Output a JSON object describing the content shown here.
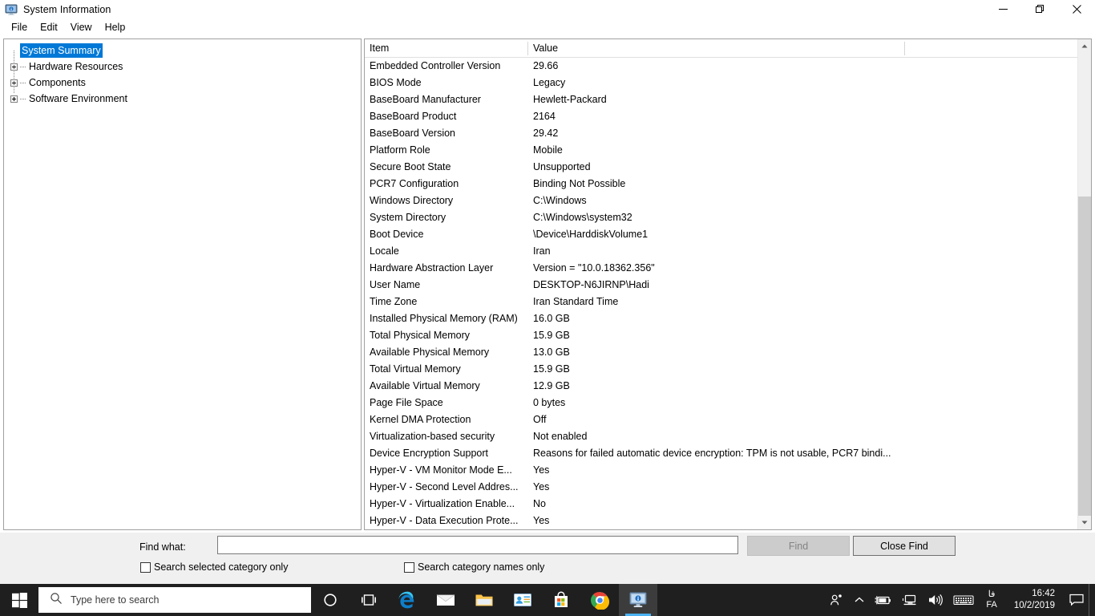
{
  "window": {
    "title": "System Information",
    "icon": "system-information-icon",
    "controls": {
      "minimize": "minimize-icon",
      "maximize": "restore-icon",
      "close": "close-icon"
    }
  },
  "menubar": {
    "items": [
      {
        "label": "File"
      },
      {
        "label": "Edit"
      },
      {
        "label": "View"
      },
      {
        "label": "Help"
      }
    ]
  },
  "tree": {
    "nodes": [
      {
        "label": "System Summary",
        "selected": true,
        "expandable": false
      },
      {
        "label": "Hardware Resources",
        "selected": false,
        "expandable": true
      },
      {
        "label": "Components",
        "selected": false,
        "expandable": true
      },
      {
        "label": "Software Environment",
        "selected": false,
        "expandable": true
      }
    ]
  },
  "list": {
    "columns": [
      "Item",
      "Value"
    ],
    "rows": [
      {
        "item": "Embedded Controller Version",
        "value": "29.66"
      },
      {
        "item": "BIOS Mode",
        "value": "Legacy"
      },
      {
        "item": "BaseBoard Manufacturer",
        "value": "Hewlett-Packard"
      },
      {
        "item": "BaseBoard Product",
        "value": "2164"
      },
      {
        "item": "BaseBoard Version",
        "value": "29.42"
      },
      {
        "item": "Platform Role",
        "value": "Mobile"
      },
      {
        "item": "Secure Boot State",
        "value": "Unsupported"
      },
      {
        "item": "PCR7 Configuration",
        "value": "Binding Not Possible"
      },
      {
        "item": "Windows Directory",
        "value": "C:\\Windows"
      },
      {
        "item": "System Directory",
        "value": "C:\\Windows\\system32"
      },
      {
        "item": "Boot Device",
        "value": "\\Device\\HarddiskVolume1"
      },
      {
        "item": "Locale",
        "value": "Iran"
      },
      {
        "item": "Hardware Abstraction Layer",
        "value": "Version = \"10.0.18362.356\""
      },
      {
        "item": "User Name",
        "value": "DESKTOP-N6JIRNP\\Hadi"
      },
      {
        "item": "Time Zone",
        "value": "Iran Standard Time"
      },
      {
        "item": "Installed Physical Memory (RAM)",
        "value": "16.0 GB"
      },
      {
        "item": "Total Physical Memory",
        "value": "15.9 GB"
      },
      {
        "item": "Available Physical Memory",
        "value": "13.0 GB"
      },
      {
        "item": "Total Virtual Memory",
        "value": "15.9 GB"
      },
      {
        "item": "Available Virtual Memory",
        "value": "12.9 GB"
      },
      {
        "item": "Page File Space",
        "value": "0 bytes"
      },
      {
        "item": "Kernel DMA Protection",
        "value": "Off"
      },
      {
        "item": "Virtualization-based security",
        "value": "Not enabled"
      },
      {
        "item": "Device Encryption Support",
        "value": "Reasons for failed automatic device encryption: TPM is not usable, PCR7 bindi..."
      },
      {
        "item": "Hyper-V - VM Monitor Mode E...",
        "value": "Yes"
      },
      {
        "item": "Hyper-V - Second Level Addres...",
        "value": "Yes"
      },
      {
        "item": "Hyper-V - Virtualization Enable...",
        "value": "No"
      },
      {
        "item": "Hyper-V - Data Execution Prote...",
        "value": "Yes"
      }
    ]
  },
  "findbar": {
    "label": "Find what:",
    "input_value": "",
    "input_placeholder": "",
    "find_button": "Find",
    "close_find_button": "Close Find",
    "checkbox_selected_category": {
      "label": "Search selected category only",
      "checked": false
    },
    "checkbox_category_names": {
      "label": "Search category names only",
      "checked": false
    }
  },
  "taskbar": {
    "start": "windows-logo-icon",
    "search_placeholder": "Type here to search",
    "pinned": [
      {
        "name": "cortana-icon"
      },
      {
        "name": "task-view-icon"
      },
      {
        "name": "microsoft-edge-icon"
      },
      {
        "name": "mail-icon"
      },
      {
        "name": "file-explorer-icon"
      },
      {
        "name": "contacts-people-icon"
      },
      {
        "name": "microsoft-store-icon"
      },
      {
        "name": "google-chrome-icon"
      },
      {
        "name": "system-information-icon",
        "active": true
      }
    ],
    "tray": {
      "people": "people-icon",
      "chevron": "show-hidden-icons-icon",
      "battery": "battery-charging-icon",
      "network": "network-icon",
      "volume": "volume-icon",
      "keyboard": "touch-keyboard-icon",
      "language_top": "فا",
      "language_bottom": "FA",
      "time": "16:42",
      "date": "10/2/2019",
      "action_center": "action-center-icon"
    }
  },
  "colors": {
    "accent": "#0078d7",
    "window_bg": "#ffffff",
    "findbar_bg": "#f0f0f0",
    "taskbar_bg": "#1f1f1f",
    "border": "#a0a0a0"
  }
}
